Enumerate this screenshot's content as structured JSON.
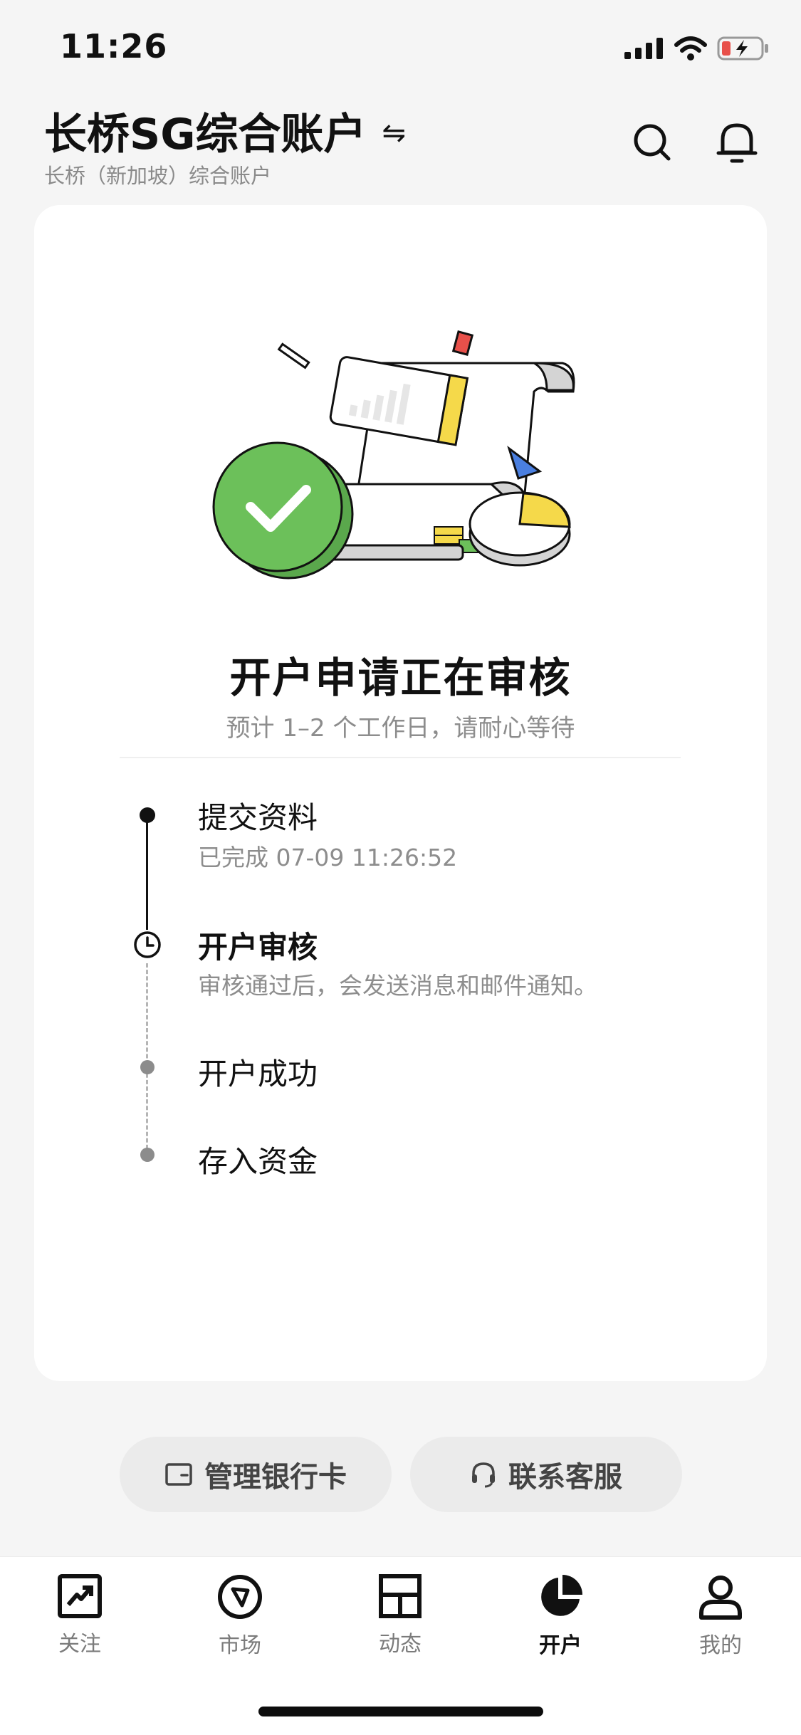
{
  "status_bar": {
    "time": "11:26",
    "icons": [
      "signal-icon",
      "wifi-icon",
      "battery-charging-icon"
    ]
  },
  "header": {
    "account_title": "长桥SG综合账户",
    "switch_icon": "⇋",
    "account_subtitle": "长桥（新加坡）综合账户",
    "icons": [
      "search-icon",
      "bell-icon"
    ]
  },
  "review_card": {
    "title": "开户申请正在审核",
    "subtitle": "预计 1–2 个工作日，请耐心等待",
    "steps": [
      {
        "title": "提交资料",
        "desc": "已完成 07-09 11:26:52",
        "state": "done"
      },
      {
        "title": "开户审核",
        "desc": "审核通过后，会发送消息和邮件通知。",
        "state": "current"
      },
      {
        "title": "开户成功",
        "state": "pending"
      },
      {
        "title": "存入资金",
        "state": "pending"
      }
    ]
  },
  "actions": {
    "manage_cards": "管理银行卡",
    "contact_support": "联系客服"
  },
  "tabbar": {
    "items": [
      {
        "label": "关注",
        "icon": "watchlist-chart-icon",
        "active": false
      },
      {
        "label": "市场",
        "icon": "compass-icon",
        "active": false
      },
      {
        "label": "动态",
        "icon": "feed-grid-icon",
        "active": false
      },
      {
        "label": "开户",
        "icon": "pie-chart-icon",
        "active": true
      },
      {
        "label": "我的",
        "icon": "profile-icon",
        "active": false
      }
    ]
  },
  "colors": {
    "success_green": "#6cc05a",
    "accent_yellow": "#f5d94a",
    "accent_red": "#e8504a",
    "accent_blue": "#4a7fe0",
    "text_primary": "#111111",
    "text_secondary": "#8d8d8d"
  }
}
